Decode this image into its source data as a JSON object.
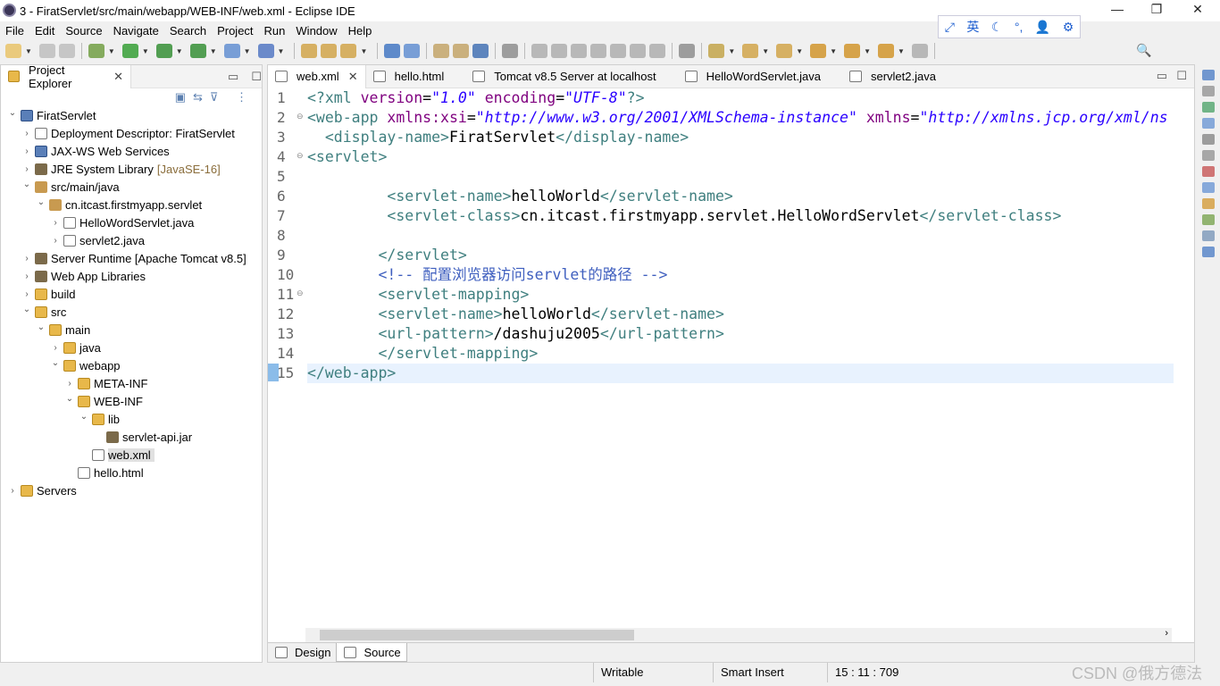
{
  "window": {
    "title": "3 - FiratServlet/src/main/webapp/WEB-INF/web.xml - Eclipse IDE",
    "minimize": "—",
    "maximize": "❐",
    "close": "✕"
  },
  "ime": {
    "items": [
      "⤢",
      "英",
      "☾",
      "°,",
      "👤",
      "⚙"
    ]
  },
  "menu": [
    "File",
    "Edit",
    "Source",
    "Navigate",
    "Search",
    "Project",
    "Run",
    "Window",
    "Help"
  ],
  "project_explorer": {
    "title": "Project Explorer",
    "tree": [
      {
        "label": "FiratServlet",
        "level": 0,
        "arrow": "open",
        "icon": "proj"
      },
      {
        "label": "Deployment Descriptor: FiratServlet",
        "level": 1,
        "arrow": "closed",
        "icon": "file"
      },
      {
        "label": "JAX-WS Web Services",
        "level": 1,
        "arrow": "closed",
        "icon": "proj"
      },
      {
        "label": "JRE System Library",
        "decor": "[JavaSE-16]",
        "level": 1,
        "arrow": "closed",
        "icon": "lib"
      },
      {
        "label": "src/main/java",
        "level": 1,
        "arrow": "open",
        "icon": "pkg"
      },
      {
        "label": "cn.itcast.firstmyapp.servlet",
        "level": 2,
        "arrow": "open",
        "icon": "pkg"
      },
      {
        "label": "HelloWordServlet.java",
        "level": 3,
        "arrow": "closed",
        "icon": "file"
      },
      {
        "label": "servlet2.java",
        "level": 3,
        "arrow": "closed",
        "icon": "file"
      },
      {
        "label": "Server Runtime [Apache Tomcat v8.5]",
        "level": 1,
        "arrow": "closed",
        "icon": "lib"
      },
      {
        "label": "Web App Libraries",
        "level": 1,
        "arrow": "closed",
        "icon": "lib"
      },
      {
        "label": "build",
        "level": 1,
        "arrow": "closed",
        "icon": "folder"
      },
      {
        "label": "src",
        "level": 1,
        "arrow": "open",
        "icon": "folder"
      },
      {
        "label": "main",
        "level": 2,
        "arrow": "open",
        "icon": "folder"
      },
      {
        "label": "java",
        "level": 3,
        "arrow": "closed",
        "icon": "folder"
      },
      {
        "label": "webapp",
        "level": 3,
        "arrow": "open",
        "icon": "folder"
      },
      {
        "label": "META-INF",
        "level": 4,
        "arrow": "closed",
        "icon": "folder"
      },
      {
        "label": "WEB-INF",
        "level": 4,
        "arrow": "open",
        "icon": "folder"
      },
      {
        "label": "lib",
        "level": 5,
        "arrow": "open",
        "icon": "folder"
      },
      {
        "label": "servlet-api.jar",
        "level": 6,
        "arrow": "none",
        "icon": "lib"
      },
      {
        "label": "web.xml",
        "level": 5,
        "arrow": "none",
        "icon": "file",
        "selected": true
      },
      {
        "label": "hello.html",
        "level": 4,
        "arrow": "none",
        "icon": "file"
      },
      {
        "label": "Servers",
        "level": 0,
        "arrow": "closed",
        "icon": "folder"
      }
    ]
  },
  "editor": {
    "tabs": [
      {
        "label": "web.xml",
        "active": true
      },
      {
        "label": "hello.html"
      },
      {
        "label": "Tomcat v8.5 Server at localhost"
      },
      {
        "label": "HelloWordServlet.java"
      },
      {
        "label": "servlet2.java"
      }
    ],
    "lines": [
      {
        "n": "1",
        "tokens": [
          [
            "tag",
            "<?xml "
          ],
          [
            "attr",
            "version"
          ],
          [
            "text",
            "="
          ],
          [
            "val",
            "\"1.0\""
          ],
          [
            "text",
            " "
          ],
          [
            "attr",
            "encoding"
          ],
          [
            "text",
            "="
          ],
          [
            "val",
            "\"UTF-8\""
          ],
          [
            "tag",
            "?>"
          ]
        ]
      },
      {
        "n": "2",
        "fold": true,
        "tokens": [
          [
            "tag",
            "<web-app "
          ],
          [
            "attr",
            "xmlns:xsi"
          ],
          [
            "text",
            "="
          ],
          [
            "val",
            "\"http://www.w3.org/2001/XMLSchema-instance\""
          ],
          [
            "text",
            " "
          ],
          [
            "attr",
            "xmlns"
          ],
          [
            "text",
            "="
          ],
          [
            "val",
            "\"http://xmlns.jcp.org/xml/ns"
          ]
        ]
      },
      {
        "n": "3",
        "tokens": [
          [
            "text",
            "  "
          ],
          [
            "tag",
            "<display-name>"
          ],
          [
            "text",
            "FiratServlet"
          ],
          [
            "tag",
            "</display-name>"
          ]
        ]
      },
      {
        "n": "4",
        "fold": true,
        "tokens": [
          [
            "tag",
            "<servlet>"
          ]
        ]
      },
      {
        "n": "5",
        "tokens": []
      },
      {
        "n": "6",
        "tokens": [
          [
            "text",
            "         "
          ],
          [
            "tag",
            "<servlet-name>"
          ],
          [
            "text",
            "helloWorld"
          ],
          [
            "tag",
            "</servlet-name>"
          ]
        ]
      },
      {
        "n": "7",
        "tokens": [
          [
            "text",
            "         "
          ],
          [
            "tag",
            "<servlet-class>"
          ],
          [
            "text",
            "cn.itcast.firstmyapp.servlet.HelloWordServlet"
          ],
          [
            "tag",
            "</servlet-class>"
          ]
        ]
      },
      {
        "n": "8",
        "tokens": []
      },
      {
        "n": "9",
        "tokens": [
          [
            "text",
            "        "
          ],
          [
            "tag",
            "</servlet>"
          ]
        ]
      },
      {
        "n": "10",
        "tokens": [
          [
            "text",
            "        "
          ],
          [
            "com",
            "<!-- 配置浏览器访问servlet的路径 -->"
          ]
        ]
      },
      {
        "n": "11",
        "fold": true,
        "tokens": [
          [
            "text",
            "        "
          ],
          [
            "tag",
            "<servlet-mapping>"
          ]
        ]
      },
      {
        "n": "12",
        "tokens": [
          [
            "text",
            "        "
          ],
          [
            "tag",
            "<servlet-name>"
          ],
          [
            "text",
            "helloWorld"
          ],
          [
            "tag",
            "</servlet-name>"
          ]
        ]
      },
      {
        "n": "13",
        "tokens": [
          [
            "text",
            "        "
          ],
          [
            "tag",
            "<url-pattern>"
          ],
          [
            "text",
            "/dashuju2005"
          ],
          [
            "tag",
            "</url-pattern>"
          ]
        ]
      },
      {
        "n": "14",
        "tokens": [
          [
            "text",
            "        "
          ],
          [
            "tag",
            "</servlet-mapping>"
          ]
        ]
      },
      {
        "n": "15",
        "current": true,
        "tokens": [
          [
            "tag",
            "</web-app>"
          ]
        ]
      }
    ],
    "bottom_tabs": [
      {
        "label": "Design"
      },
      {
        "label": "Source",
        "active": true
      }
    ],
    "scroll_fraction": 0.37
  },
  "status": {
    "writable": "Writable",
    "insert_mode": "Smart Insert",
    "position": "15 : 11 : 709"
  },
  "watermark": "CSDN @俄方德法"
}
